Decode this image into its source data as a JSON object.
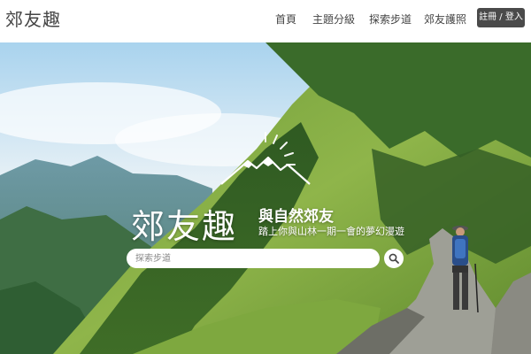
{
  "header": {
    "logo_text": "郊友趣",
    "nav": [
      {
        "label": "首頁"
      },
      {
        "label": "主題分級"
      },
      {
        "label": "探索步道"
      },
      {
        "label": "郊友護照"
      }
    ],
    "auth_button_label": "註冊 / 登入"
  },
  "hero": {
    "brand_title": "郊友趣",
    "slogan": "與自然郊友",
    "subtitle": "踏上你與山林一期一會的夢幻漫遊",
    "search": {
      "placeholder": "探索步道",
      "value": ""
    },
    "icons": {
      "search_button": "search-icon",
      "mountain_logo": "mountain-sun-icon"
    }
  },
  "colors": {
    "header_bg": "#ffffff",
    "nav_text": "#444444",
    "auth_button_bg": "#4a4a4a",
    "hero_text": "#ffffff"
  }
}
